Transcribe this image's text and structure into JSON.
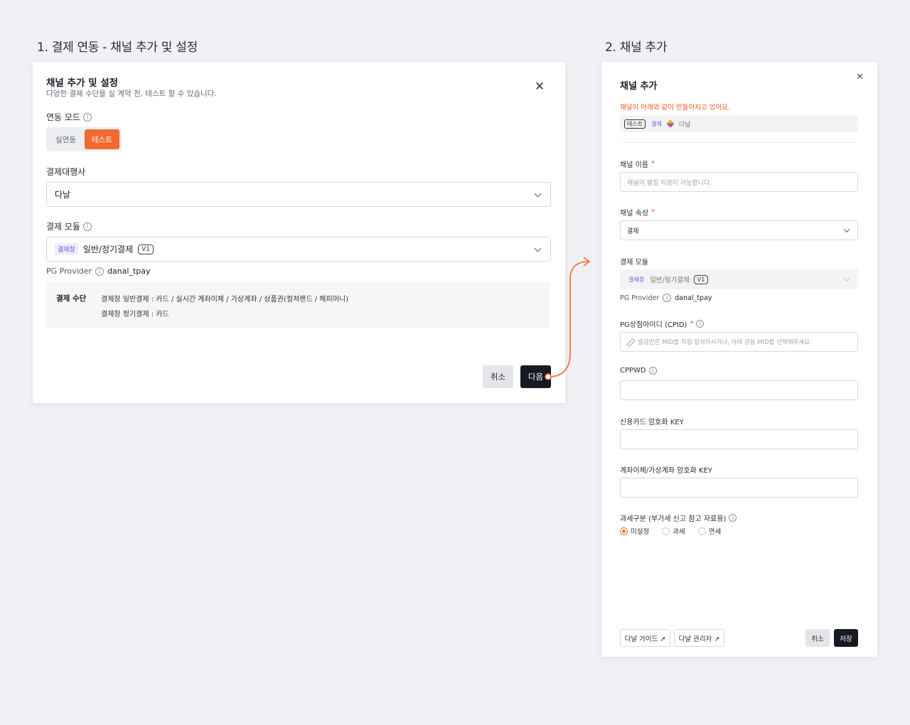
{
  "step1": {
    "heading": "1. 결제 연동 - 채널 추가 및 설정",
    "panel": {
      "title": "채널 추가 및 설정",
      "subtitle": "다양한 결제 수단을 실 계약 전, 테스트 할 수 있습니다.",
      "close_symbol": "✕",
      "mode_label": "연동 모드",
      "mode_options": [
        "실연동",
        "테스트"
      ],
      "mode_selected": "테스트",
      "pg_label": "결제대행사",
      "pg_value": "다날",
      "module_label": "결제 모듈",
      "module_badge": "결제창",
      "module_value": "일반/정기결제",
      "module_version": "V1",
      "provider_label": "PG Provider",
      "provider_value": "danal_tpay",
      "methods_label": "결제 수단",
      "methods_line1": "결제창 일반결제 : 카드 / 실시간 계좌이체 / 가상계좌 / 상품권(컬쳐랜드 / 해피머니)",
      "methods_line2": "결제창 정기결제 : 카드",
      "cancel_label": "취소",
      "next_label": "다음"
    }
  },
  "step2": {
    "heading": "2. 채널 추가",
    "panel": {
      "title": "채널 추가",
      "close_symbol": "✕",
      "notice": "채널이 아래와 같이 만들어지고 있어요.",
      "preview_tag_env": "테스트",
      "preview_tag_type": "결제",
      "preview_pg": "다날",
      "channel_name_label": "채널 이름",
      "channel_name_placeholder": "채널의 별칭 지정이 가능합니다.",
      "channel_attr_label": "채널 속성",
      "channel_attr_value": "결제",
      "module_label": "결제 모듈",
      "module_badge": "결제창",
      "module_value": "일반/정기결제",
      "module_version": "V1",
      "provider_label": "PG Provider",
      "provider_value": "danal_tpay",
      "cpid_label": "PG상점아이디 (CPID)",
      "cpid_placeholder": "발급받은 MID를 직접 입력하시거나, 아래 공용 MID를 선택해주세요.",
      "cppwd_label": "CPPWD",
      "card_key_label": "신용카드 암호화 KEY",
      "transfer_key_label": "계좌이체/가상계좌 암호화 KEY",
      "tax_label": "과세구분 (부가세 신고 참고 자료용)",
      "tax_options": [
        "미설정",
        "과세",
        "면세"
      ],
      "tax_selected": "미설정",
      "guide_btn": "다날 가이드 ↗",
      "admin_btn": "다날 관리자 ↗",
      "cancel_label": "취소",
      "save_label": "저장"
    }
  },
  "colors": {
    "accent": "#f26a2e",
    "dark": "#161a22",
    "background": "#f0f1f5"
  }
}
